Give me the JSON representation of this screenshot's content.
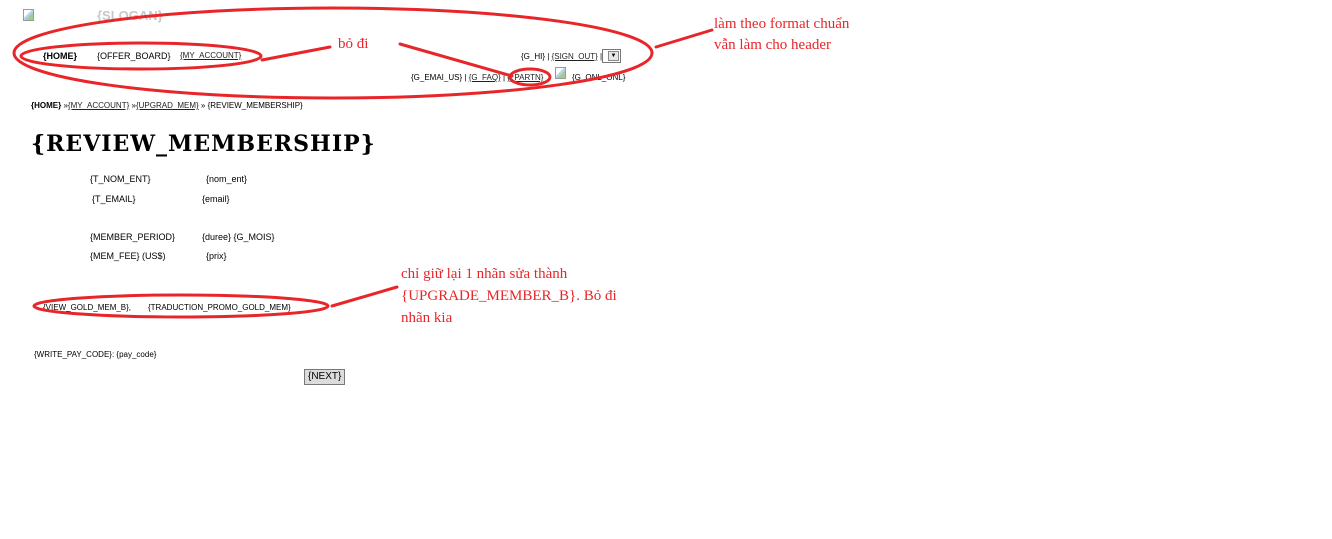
{
  "header": {
    "slogan": "{SLOGAN}",
    "nav": {
      "home": "{HOME}",
      "offer_board": "{OFFER_BOARD}",
      "my_account": "{MY_ACCOUNT}"
    },
    "top_right": {
      "g_hi": "{G_HI}",
      "sep1": "|",
      "sign_out": "{SIGN_OUT}",
      "sep2": "|"
    },
    "bottom_right": {
      "email_us": "{G_EMAI_US}",
      "sep1": "|",
      "faq": "{G_FAQ}",
      "sep2": "|",
      "partner": "{_PARTN}",
      "online": "{G_ONL_ONL}"
    }
  },
  "breadcrumb": {
    "home": "{HOME}",
    "sep1": "»",
    "my_account": "{MY_ACCOUNT}",
    "sep2": "»",
    "upgrade": "{UPGRAD_MEM}",
    "sep3": "»",
    "current": "{REVIEW_MEMBERSHIP}"
  },
  "page_title": "{REVIEW_MEMBERSHIP}",
  "details": {
    "nom_label": "{T_NOM_ENT}",
    "nom_value": "{nom_ent}",
    "email_label": "{T_EMAIL}",
    "email_value": "{email}",
    "period_label": "{MEMBER_PERIOD}",
    "period_value": "{duree} {G_MOIS}",
    "fee_label": "{MEM_FEE} (US$)",
    "fee_value": "{prix}"
  },
  "upgrade_labels": {
    "view_gold": "{VIEW_GOLD_MEM_B},",
    "promo": "{TRADUCTION_PROMO_GOLD_MEM}"
  },
  "payment": {
    "label": "{WRITE_PAY_CODE}:",
    "value": "{pay_code}"
  },
  "next_button": "{NEXT}",
  "annotations": {
    "remove": "bỏ đi",
    "header_line1": "làm theo format chuẩn",
    "header_line2": "vẫn làm cho header",
    "keep_line1": "chỉ giữ lại 1 nhãn sửa thành",
    "keep_line2": "{UPGRADE_MEMBER_B}. Bỏ đi",
    "keep_line3": "nhãn kia"
  },
  "colors": {
    "annotation_red": "#e8262a"
  }
}
